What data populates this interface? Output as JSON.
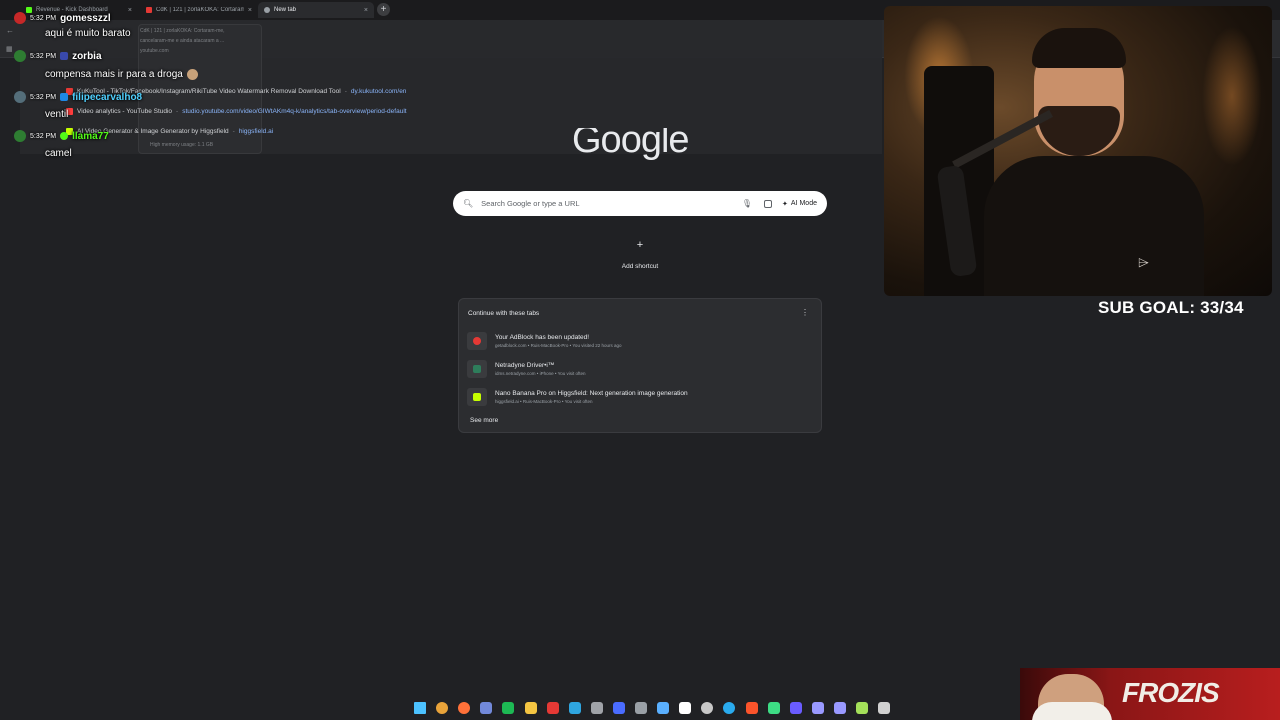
{
  "tabs": [
    {
      "title": "Revenue - Kick Dashboard",
      "favicon_color": "#53fc18"
    },
    {
      "title": "CdK | 121 | zorlaKOKA: Cortaram-",
      "favicon_color": "#e53935"
    },
    {
      "title": "New tab",
      "favicon_color": "#9aa0a6"
    }
  ],
  "tab_close_glyph": "×",
  "new_tab_glyph": "+",
  "omnibox_dropdown": {
    "suggestions": [
      {
        "title": "KuKuTool - TikTok/Facebook/Instagram/RikiTube Video Watermark Removal Download Tool",
        "url": "dy.kukutool.com/en",
        "icon_color": "#e53935"
      },
      {
        "title": "Video analytics - YouTube Studio",
        "url": "studio.youtube.com/video/GIWtAKm4q-k/analytics/tab-overview/period-default",
        "icon_color": "#ff3d3d"
      },
      {
        "title": "AI Video Generator & Image Generator by Higgsfield",
        "url": "higgsfield.ai",
        "icon_color": "#c6ff00"
      }
    ],
    "popup_title": "CdK | 121 | zorlaKOKA: Cortaram-me,",
    "popup_line2": "cancelaram-me e ainda atacaram a ...",
    "popup_memory": "High memory usage: 1.1 GB",
    "popup_host": "youtube.com"
  },
  "chat": [
    {
      "time": "5:32 PM",
      "user": "gomesszzl",
      "user_color": "#ffffff",
      "message": ""
    },
    {
      "time": "",
      "user": "",
      "user_color": "#ffffff",
      "message": "aqui é muito barato"
    },
    {
      "time": "5:32 PM",
      "user": "zorbia",
      "user_color": "#ffffff",
      "message": ""
    },
    {
      "time": "",
      "user": "",
      "user_color": "#ffffff",
      "message": "compensa mais ir para a droga"
    },
    {
      "time": "5:32 PM",
      "user": "filipecarvalho8",
      "user_color": "#4fd1ff",
      "message": ""
    },
    {
      "time": "",
      "user": "",
      "user_color": "#ffffff",
      "message": "ventil"
    },
    {
      "time": "5:32 PM",
      "user": "llama77",
      "user_color": "#53fc18",
      "message": ""
    },
    {
      "time": "",
      "user": "",
      "user_color": "#ffffff",
      "message": "camel"
    }
  ],
  "ntp": {
    "logo": "Google",
    "search_placeholder": "Search Google or type a URL",
    "ai_mode_label": "AI Mode",
    "add_shortcut_label": "Add shortcut",
    "continue_header": "Continue with these tabs",
    "continue_items": [
      {
        "title": "Your AdBlock has been updated!",
        "subtitle": "getadblock.com • Ruis-MacBook-Pro • You visited 22 hours ago",
        "icon_color": "#e53935"
      },
      {
        "title": "Netradyne Driver•i™",
        "subtitle": "idms.netradyne.com • iPhone • You visit often",
        "icon_color": "#2e7d5b"
      },
      {
        "title": "Nano Banana Pro on Higgsfield: Next generation image generation",
        "subtitle": "higgsfield.ai • Ruis-MacBook-Pro • You visit often",
        "icon_color": "#c6ff00"
      }
    ],
    "see_more": "See more"
  },
  "stream": {
    "sub_goal": "SUB GOAL: 33/34",
    "brand": "FROZIS"
  },
  "taskbar_icons": [
    {
      "name": "windows-start-icon",
      "color": "#4cc2ff"
    },
    {
      "name": "chrome-icon",
      "color": "#e8a33a"
    },
    {
      "name": "firefox-icon",
      "color": "#ff7139"
    },
    {
      "name": "discord-icon",
      "color": "#7289da"
    },
    {
      "name": "spotify-icon",
      "color": "#1db954"
    },
    {
      "name": "file-explorer-icon",
      "color": "#f4c542"
    },
    {
      "name": "app-icon",
      "color": "#e53935"
    },
    {
      "name": "edge-icon",
      "color": "#2fa6e0"
    },
    {
      "name": "app-icon",
      "color": "#a0a3a8"
    },
    {
      "name": "media-icon",
      "color": "#4a6cff"
    },
    {
      "name": "app-icon",
      "color": "#9aa0a6"
    },
    {
      "name": "app-icon",
      "color": "#5ab0ff"
    },
    {
      "name": "capcut-icon",
      "color": "#ffffff"
    },
    {
      "name": "settings-icon",
      "color": "#c8c8c8"
    },
    {
      "name": "telegram-icon",
      "color": "#2aabee"
    },
    {
      "name": "brave-icon",
      "color": "#fb542b"
    },
    {
      "name": "app-icon",
      "color": "#3ddc84"
    },
    {
      "name": "vpn-icon",
      "color": "#6a5cff"
    },
    {
      "name": "premiere-icon",
      "color": "#9999ff"
    },
    {
      "name": "after-effects-icon",
      "color": "#9999ff"
    },
    {
      "name": "app-icon",
      "color": "#a4e05a"
    },
    {
      "name": "app-icon",
      "color": "#d0d0d0"
    }
  ]
}
